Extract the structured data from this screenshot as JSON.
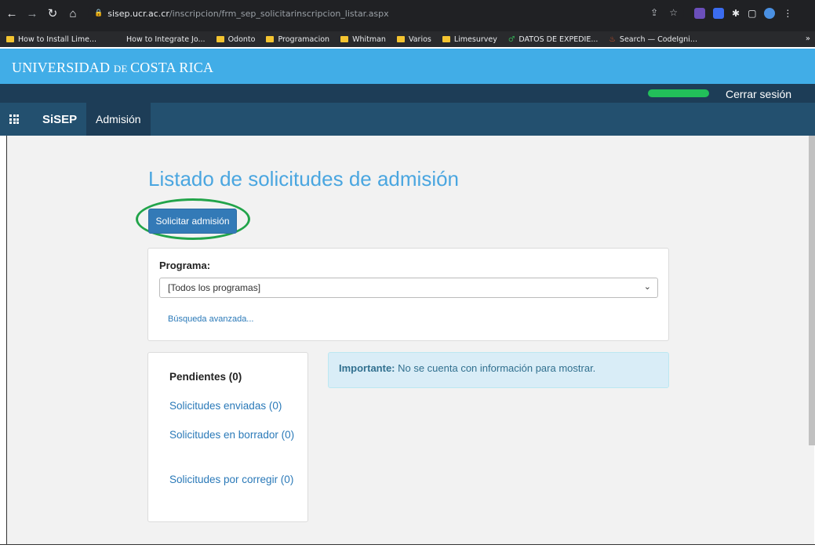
{
  "browser": {
    "url_host": "sisep.ucr.ac.cr",
    "url_path": "/inscripcion/frm_sep_solicitarinscripcion_listar.aspx",
    "bookmarks": [
      "How to Install Lime...",
      "How to Integrate Jo...",
      "Odonto",
      "Programacion",
      "Whitman",
      "Varios",
      "Limesurvey",
      "DATOS DE EXPEDIE...",
      "Search — CodeIgni..."
    ]
  },
  "header": {
    "logo_part1": "UNIVERSIDAD ",
    "logo_part2": "DE ",
    "logo_part3": "COSTA RICA",
    "logout_label": "Cerrar sesión"
  },
  "menu": {
    "brand": "SiSEP",
    "admision": "Admisión"
  },
  "main": {
    "title": "Listado de solicitudes de admisión",
    "solicitar_label": "Solicitar admisión",
    "programa_label": "Programa:",
    "programa_value": "[Todos los programas]",
    "busqueda_label": "Búsqueda avanzada..."
  },
  "side": {
    "pendientes": "Pendientes (0)",
    "enviadas": "Solicitudes enviadas (0)",
    "borrador": "Solicitudes en borrador (0)",
    "corregir": "Solicitudes por corregir (0)"
  },
  "alert": {
    "strong": "Importante:",
    "text": " No se cuenta con información para mostrar."
  }
}
